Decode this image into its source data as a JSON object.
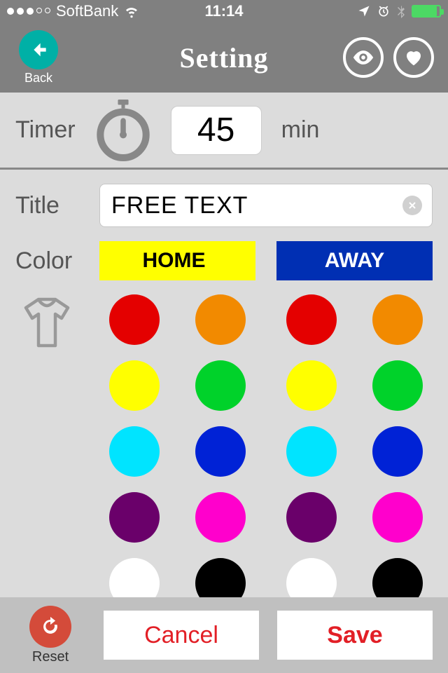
{
  "status": {
    "carrier": "SoftBank",
    "time": "11:14"
  },
  "header": {
    "back_label": "Back",
    "title": "Setting"
  },
  "timer": {
    "label": "Timer",
    "value": "45",
    "unit": "min"
  },
  "form": {
    "title_label": "Title",
    "title_value": "FREE TEXT",
    "color_label": "Color",
    "home_tab": "HOME",
    "away_tab": "AWAY"
  },
  "colors": {
    "home": [
      "#e40000",
      "#f28a00",
      "#ffff00",
      "#00d22a",
      "#00e4ff",
      "#0022d6",
      "#6a006a",
      "#ff00cc",
      "#ffffff",
      "#000000"
    ],
    "away": [
      "#e40000",
      "#f28a00",
      "#ffff00",
      "#00d22a",
      "#00e4ff",
      "#0022d6",
      "#6a006a",
      "#ff00cc",
      "#ffffff",
      "#000000"
    ]
  },
  "footer": {
    "reset_label": "Reset",
    "cancel_label": "Cancel",
    "save_label": "Save"
  }
}
